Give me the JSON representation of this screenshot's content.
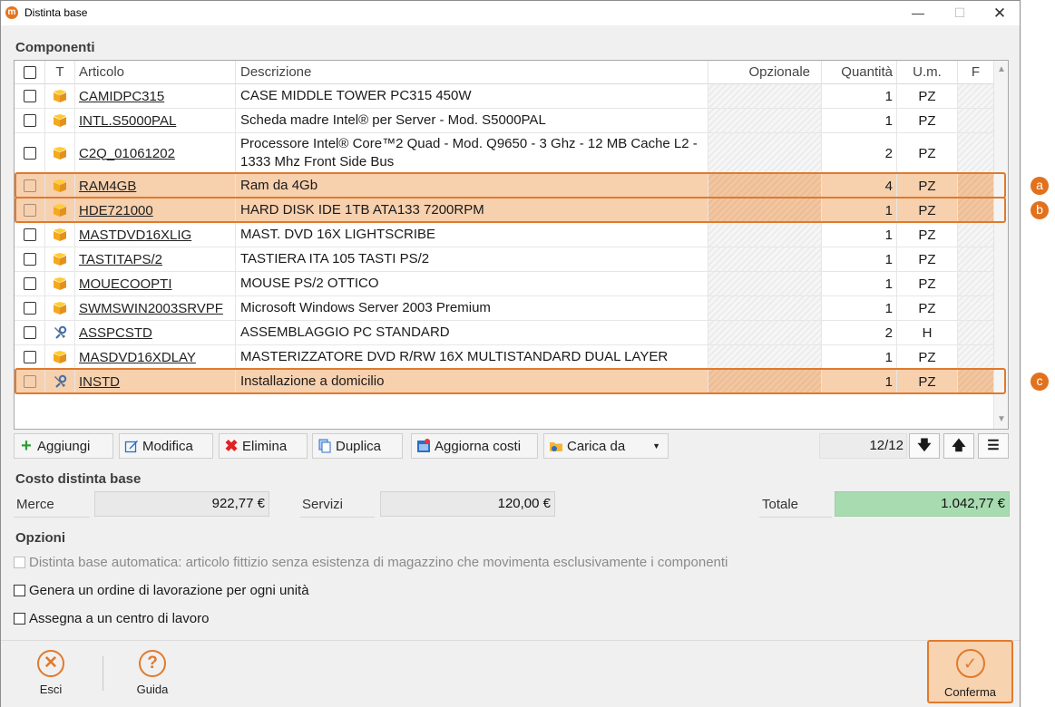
{
  "window": {
    "title": "Distinta base",
    "app_icon": "m"
  },
  "components": {
    "title": "Componenti",
    "columns": {
      "type": "T",
      "article": "Articolo",
      "description": "Descrizione",
      "optional": "Opzionale",
      "quantity": "Quantità",
      "unit": "U.m.",
      "f": "F"
    },
    "rows": [
      {
        "article": "CAMIDPC315",
        "description": "CASE MIDDLE TOWER PC315 450W",
        "quantity": "1",
        "unit": "PZ",
        "type_icon": "box-icon",
        "highlighted": false
      },
      {
        "article": "INTL.S5000PAL",
        "description": "Scheda madre Intel® per Server - Mod. S5000PAL",
        "quantity": "1",
        "unit": "PZ",
        "type_icon": "box-icon",
        "highlighted": false
      },
      {
        "article": "C2Q_01061202",
        "description": "Processore Intel® Core™2 Quad - Mod. Q9650 - 3 Ghz - 12 MB Cache L2 - 1333 Mhz Front Side Bus",
        "quantity": "2",
        "unit": "PZ",
        "type_icon": "box-icon",
        "highlighted": false
      },
      {
        "article": "RAM4GB",
        "description": "Ram da 4Gb",
        "quantity": "4",
        "unit": "PZ",
        "type_icon": "box-icon",
        "highlighted": true,
        "callout": "a"
      },
      {
        "article": "HDE721000",
        "description": "HARD DISK IDE 1TB ATA133 7200RPM",
        "quantity": "1",
        "unit": "PZ",
        "type_icon": "box-icon",
        "highlighted": true,
        "callout": "b"
      },
      {
        "article": "MASTDVD16XLIG",
        "description": "MAST.  DVD 16X  LIGHTSCRIBE",
        "quantity": "1",
        "unit": "PZ",
        "type_icon": "box-icon",
        "highlighted": false
      },
      {
        "article": "TASTITAPS/2",
        "description": "TASTIERA ITA 105 TASTI PS/2",
        "quantity": "1",
        "unit": "PZ",
        "type_icon": "box-icon",
        "highlighted": false
      },
      {
        "article": "MOUECOOPTI",
        "description": "MOUSE PS/2 OTTICO",
        "quantity": "1",
        "unit": "PZ",
        "type_icon": "box-icon",
        "highlighted": false
      },
      {
        "article": "SWMSWIN2003SRVPF",
        "description": "Microsoft Windows Server 2003 Premium",
        "quantity": "1",
        "unit": "PZ",
        "type_icon": "box-icon",
        "highlighted": false
      },
      {
        "article": "ASSPCSTD",
        "description": "ASSEMBLAGGIO PC STANDARD",
        "quantity": "2",
        "unit": "H",
        "type_icon": "service-icon",
        "highlighted": false
      },
      {
        "article": "MASDVD16XDLAY",
        "description": "MASTERIZZATORE DVD R/RW 16X MULTISTANDARD DUAL LAYER",
        "quantity": "1",
        "unit": "PZ",
        "type_icon": "box-icon",
        "highlighted": false
      },
      {
        "article": "INSTD",
        "description": "Installazione a domicilio",
        "quantity": "1",
        "unit": "PZ",
        "type_icon": "service-icon",
        "highlighted": true,
        "callout": "c"
      }
    ]
  },
  "toolbar": {
    "add": "Aggiungi",
    "edit": "Modifica",
    "delete": "Elimina",
    "duplicate": "Duplica",
    "update_costs": "Aggiorna costi",
    "load_from": "Carica da",
    "counter": "12/12"
  },
  "costs": {
    "title": "Costo distinta base",
    "goods_label": "Merce",
    "goods_value": "922,77 €",
    "services_label": "Servizi",
    "services_value": "120,00 €",
    "total_label": "Totale",
    "total_value": "1.042,77 €"
  },
  "options": {
    "title": "Opzioni",
    "auto_bom": "Distinta base automatica: articolo fittizio senza esistenza di magazzino che movimenta esclusivamente i componenti",
    "work_order_per_unit": "Genera un ordine di lavorazione per ogni unità",
    "assign_work_center": "Assegna a un centro di lavoro"
  },
  "footer": {
    "exit": "Esci",
    "help": "Guida",
    "confirm": "Conferma"
  },
  "colors": {
    "accent": "#e07a2d",
    "highlight_row": "#f7d0ae",
    "total_bg": "#a8dcb0"
  }
}
